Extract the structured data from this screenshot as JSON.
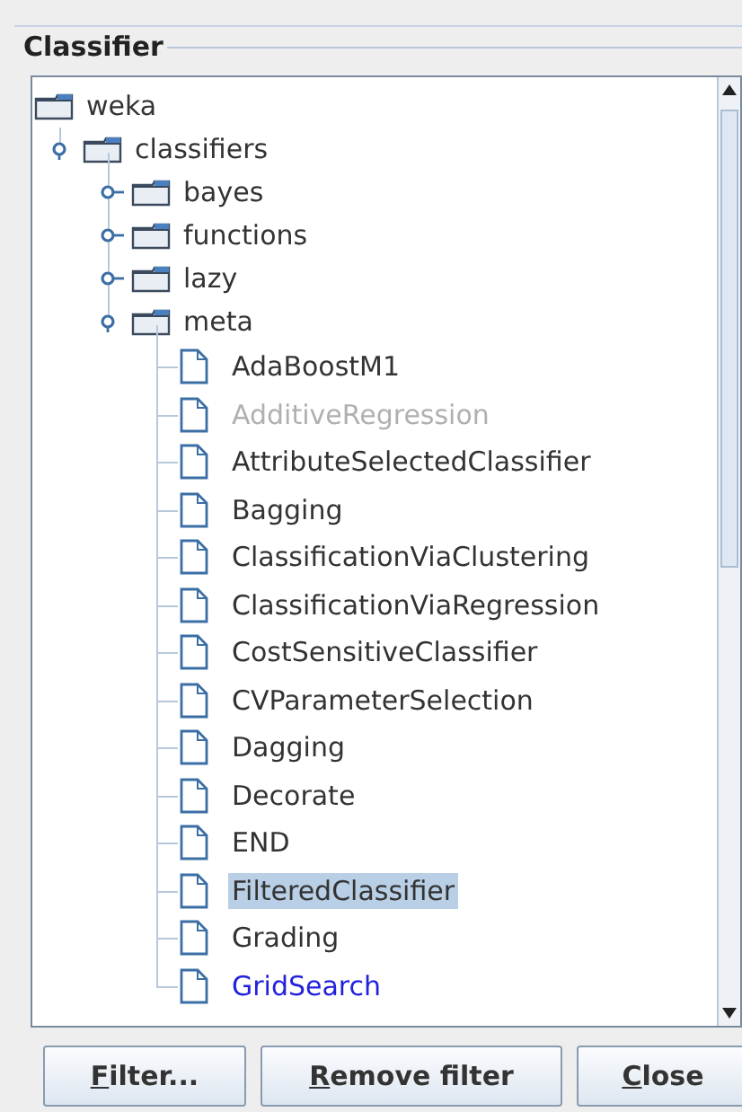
{
  "panel": {
    "title": "Classifier"
  },
  "tree": {
    "kind": "folder",
    "label": "weka",
    "children": [
      {
        "kind": "folder",
        "label": "classifiers",
        "expanded": true,
        "children": [
          {
            "kind": "folder",
            "label": "bayes",
            "expanded": false
          },
          {
            "kind": "folder",
            "label": "functions",
            "expanded": false
          },
          {
            "kind": "folder",
            "label": "lazy",
            "expanded": false
          },
          {
            "kind": "folder",
            "label": "meta",
            "expanded": true,
            "children": [
              {
                "label": "AdaBoostM1",
                "disabled": false,
                "marked": false,
                "selected": false
              },
              {
                "label": "AdditiveRegression",
                "disabled": true,
                "marked": false,
                "selected": false
              },
              {
                "label": "AttributeSelectedClassifier",
                "disabled": false,
                "marked": false,
                "selected": false
              },
              {
                "label": "Bagging",
                "disabled": false,
                "marked": false,
                "selected": false
              },
              {
                "label": "ClassificationViaClustering",
                "disabled": false,
                "marked": false,
                "selected": false
              },
              {
                "label": "ClassificationViaRegression",
                "disabled": false,
                "marked": false,
                "selected": false
              },
              {
                "label": "CostSensitiveClassifier",
                "disabled": false,
                "marked": false,
                "selected": false
              },
              {
                "label": "CVParameterSelection",
                "disabled": false,
                "marked": false,
                "selected": false
              },
              {
                "label": "Dagging",
                "disabled": false,
                "marked": false,
                "selected": false
              },
              {
                "label": "Decorate",
                "disabled": false,
                "marked": false,
                "selected": false
              },
              {
                "label": "END",
                "disabled": false,
                "marked": false,
                "selected": false
              },
              {
                "label": "FilteredClassifier",
                "disabled": false,
                "marked": false,
                "selected": true
              },
              {
                "label": "Grading",
                "disabled": false,
                "marked": false,
                "selected": false
              },
              {
                "label": "GridSearch",
                "disabled": false,
                "marked": true,
                "selected": false
              }
            ]
          }
        ]
      }
    ]
  },
  "buttons": [
    "Filter...",
    "Remove filter",
    "Close"
  ]
}
